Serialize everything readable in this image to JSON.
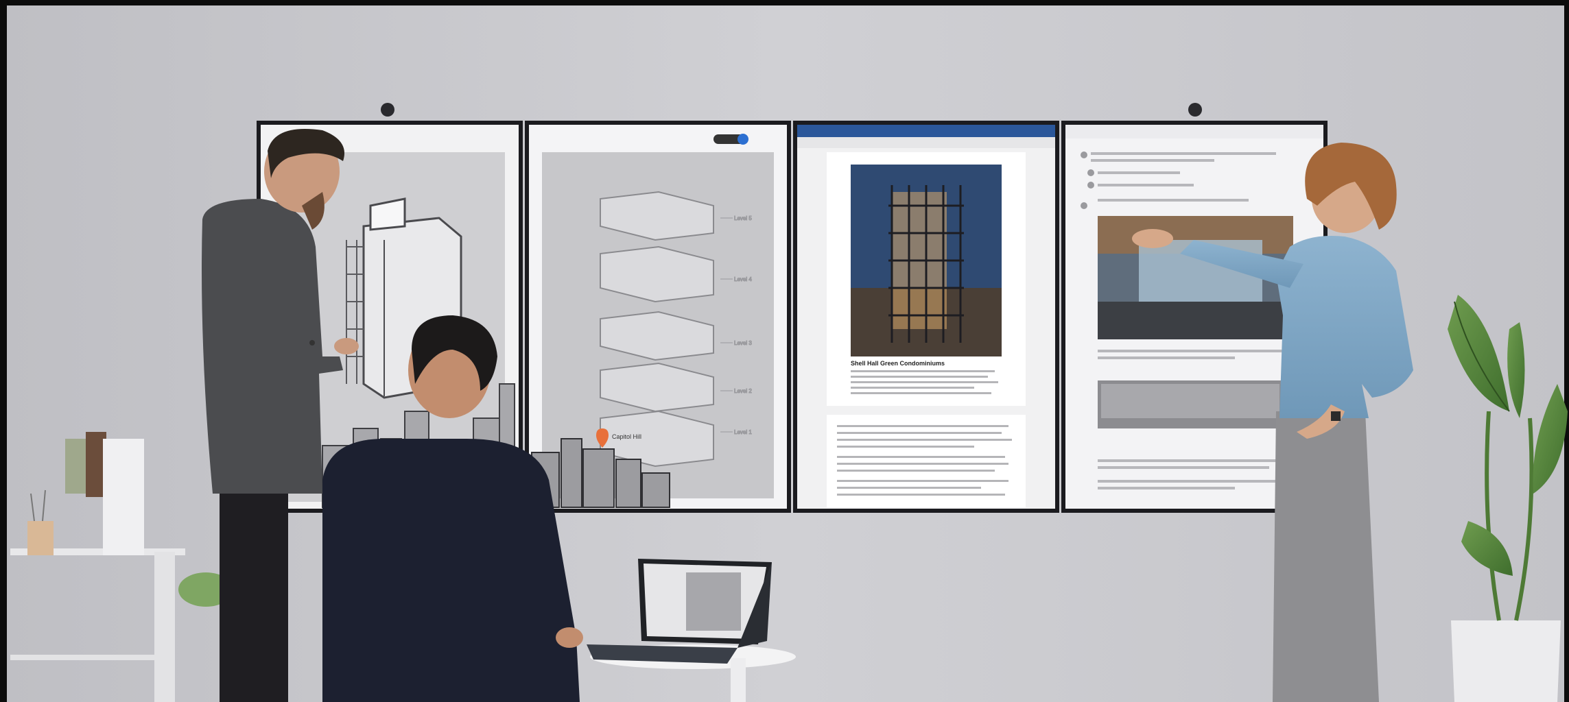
{
  "scene": {
    "kind": "photo",
    "panels": [
      {
        "id": "panel-1",
        "content": "architectural-sketch"
      },
      {
        "id": "panel-2",
        "content": "exploded-building-floors"
      },
      {
        "id": "panel-3",
        "content": "word-document",
        "doc_heading": "Shell Hall Green Condominiums"
      },
      {
        "id": "panel-4",
        "content": "teams-chat"
      }
    ],
    "panel2_labels": [
      "Level 5",
      "Level 4",
      "Level 3",
      "Level 2",
      "Level 1"
    ],
    "pin_label": "Capitol Hill",
    "colors": {
      "wall": "#c9c9cd",
      "wall_dark": "#b8b8bd",
      "bezel": "#1b1b1f",
      "screen": "#f4f4f6",
      "word_ribbon": "#2b579a",
      "pin": "#e8703a"
    }
  }
}
